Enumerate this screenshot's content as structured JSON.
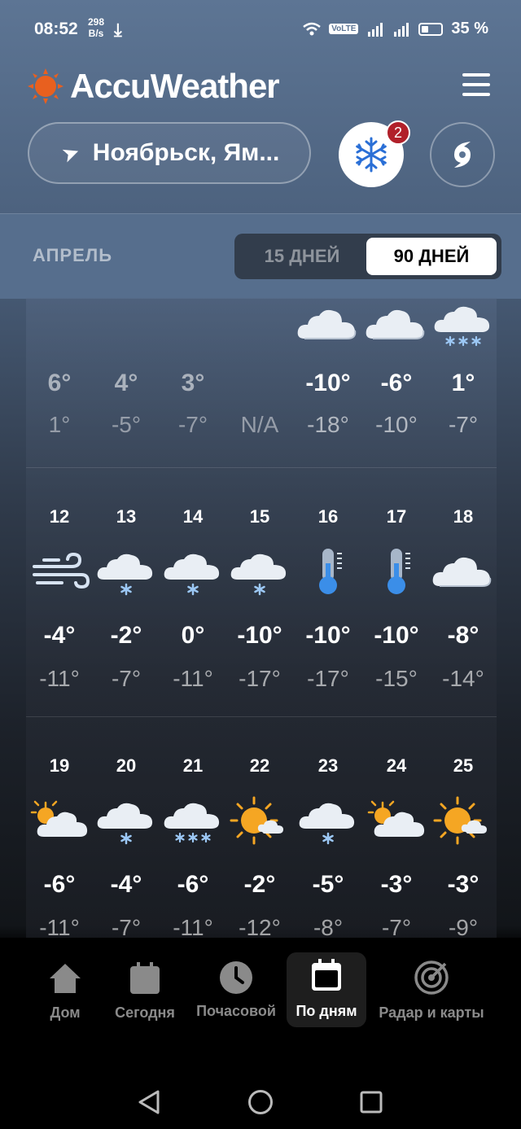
{
  "status": {
    "time": "08:52",
    "speed_value": "298",
    "speed_unit": "B/s",
    "battery": "35 %"
  },
  "app": {
    "name": "AccuWeather"
  },
  "location": {
    "text": "Ноябрьск, Ям..."
  },
  "alerts": {
    "count": "2"
  },
  "tabs": {
    "month": "АПРЕЛЬ",
    "days15": "15 ДНЕЙ",
    "days90": "90 ДНЕЙ",
    "selected": "90 ДНЕЙ"
  },
  "weeks": [
    {
      "days": [
        {
          "date": "",
          "icon": "none",
          "hi": "6°",
          "lo": "1°",
          "past": true
        },
        {
          "date": "",
          "icon": "none",
          "hi": "4°",
          "lo": "-5°",
          "past": true
        },
        {
          "date": "",
          "icon": "none",
          "hi": "3°",
          "lo": "-7°",
          "past": true
        },
        {
          "date": "",
          "icon": "none",
          "hi": "",
          "lo": "N/A",
          "past": true
        },
        {
          "date": "",
          "icon": "cloud",
          "hi": "-10°",
          "lo": "-18°",
          "past": false
        },
        {
          "date": "",
          "icon": "cloud",
          "hi": "-6°",
          "lo": "-10°",
          "past": false
        },
        {
          "date": "",
          "icon": "snow-heavy",
          "hi": "1°",
          "lo": "-7°",
          "past": false
        }
      ]
    },
    {
      "days": [
        {
          "date": "12",
          "icon": "wind",
          "hi": "-4°",
          "lo": "-11°"
        },
        {
          "date": "13",
          "icon": "snow",
          "hi": "-2°",
          "lo": "-7°"
        },
        {
          "date": "14",
          "icon": "snow",
          "hi": "0°",
          "lo": "-11°"
        },
        {
          "date": "15",
          "icon": "snow",
          "hi": "-10°",
          "lo": "-17°"
        },
        {
          "date": "16",
          "icon": "cold",
          "hi": "-10°",
          "lo": "-17°"
        },
        {
          "date": "17",
          "icon": "cold",
          "hi": "-10°",
          "lo": "-15°"
        },
        {
          "date": "18",
          "icon": "cloud",
          "hi": "-8°",
          "lo": "-14°"
        }
      ]
    },
    {
      "days": [
        {
          "date": "19",
          "icon": "partly-cloudy",
          "hi": "-6°",
          "lo": "-11°"
        },
        {
          "date": "20",
          "icon": "snow",
          "hi": "-4°",
          "lo": "-7°"
        },
        {
          "date": "21",
          "icon": "snow-heavy",
          "hi": "-6°",
          "lo": "-11°"
        },
        {
          "date": "22",
          "icon": "sun-cloud",
          "hi": "-2°",
          "lo": "-12°"
        },
        {
          "date": "23",
          "icon": "snow",
          "hi": "-5°",
          "lo": "-8°"
        },
        {
          "date": "24",
          "icon": "partly-cloudy",
          "hi": "-3°",
          "lo": "-7°"
        },
        {
          "date": "25",
          "icon": "sun-cloud",
          "hi": "-3°",
          "lo": "-9°"
        }
      ]
    }
  ],
  "nav": [
    {
      "label": "Дом",
      "icon": "home-icon"
    },
    {
      "label": "Сегодня",
      "icon": "calendar-today-icon"
    },
    {
      "label": "Почасовой",
      "icon": "clock-icon"
    },
    {
      "label": "По дням",
      "icon": "calendar-daily-icon",
      "active": true
    },
    {
      "label": "Радар и карты",
      "icon": "radar-icon"
    }
  ],
  "colors": {
    "accent_orange": "#e8601f",
    "badge_red": "#b1202a",
    "header_blue": "#5d7594"
  }
}
